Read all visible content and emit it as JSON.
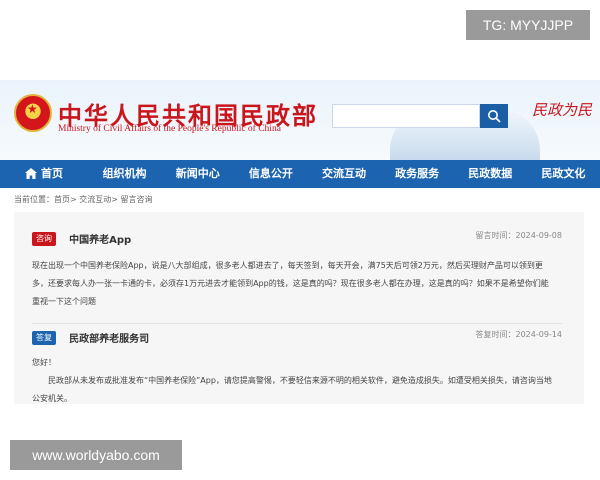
{
  "watermark_top": "TG: MYYJJPP",
  "watermark_bottom": "www.worldyabo.com",
  "header": {
    "title": "中华人民共和国民政部",
    "subtitle": "Ministry of Civil Affairs of the People's Republic of China",
    "search_placeholder": "",
    "calligraphy": "民政为民"
  },
  "nav": {
    "items": [
      {
        "label": "首页"
      },
      {
        "label": "组织机构"
      },
      {
        "label": "新闻中心"
      },
      {
        "label": "信息公开"
      },
      {
        "label": "交流互动"
      },
      {
        "label": "政务服务"
      },
      {
        "label": "民政数据"
      },
      {
        "label": "民政文化"
      }
    ]
  },
  "breadcrumb": "当前位置：首页> 交流互动> 留言咨询",
  "question": {
    "badge": "咨询",
    "name": "中国养老App",
    "time": "留言时间：2024-09-08",
    "body": "现在出现一个中国养老保险App，说是八大部组成，很多老人都进去了，每天签到，每天开会，满75天后可领2万元，然后买理财产品可以领到更多，还要求每人办一张一卡通的卡，必须存1万元进去才能领到App的钱，这是真的吗？现在很多老人都在办理，这是真的吗？如果不是希望你们能重视一下这个问题"
  },
  "reply": {
    "badge": "答复",
    "name": "民政部养老服务司",
    "time": "答复时间：2024-09-14",
    "greeting": "您好！",
    "body": "民政部从未发布或批准发布“中国养老保险”App，请您提高警惕，不要轻信来源不明的相关软件，避免造成损失。如遭受相关损失，请咨询当地公安机关。"
  },
  "colors": {
    "brand_red": "#c9161d",
    "nav_blue": "#1d64b0"
  },
  "icons": [
    "emblem-icon",
    "search-icon",
    "home-icon"
  ]
}
